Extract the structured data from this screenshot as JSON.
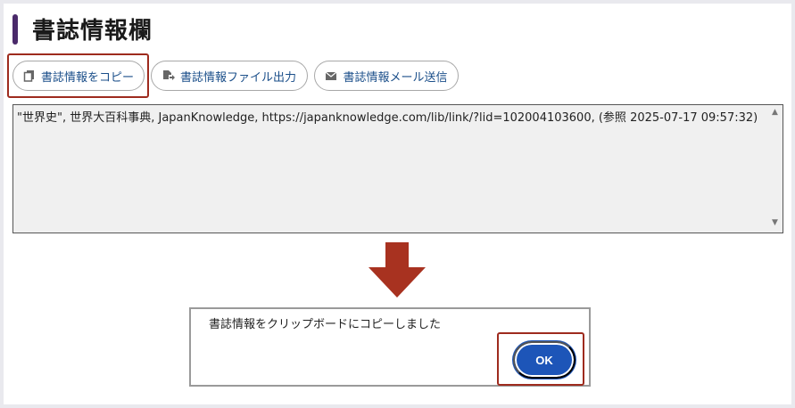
{
  "section": {
    "title": "書誌情報欄"
  },
  "buttons": {
    "copy": {
      "label": "書誌情報をコピー",
      "icon": "copy-icon"
    },
    "file": {
      "label": "書誌情報ファイル出力",
      "icon": "file-export-icon"
    },
    "mail": {
      "label": "書誌情報メール送信",
      "icon": "envelope-icon"
    }
  },
  "citation": {
    "text": "\"世界史\", 世界大百科事典, JapanKnowledge, https://japanknowledge.com/lib/link/?lid=102004103600, (参照 2025-07-17 09:57:32)"
  },
  "dialog": {
    "message": "書誌情報をクリップボードにコピーしました",
    "ok_label": "OK"
  },
  "colors": {
    "accent_bar": "#4a2a6a",
    "highlight": "#9e2b1e",
    "button_text": "#1b4f8a",
    "ok_button": "#1d55b8"
  }
}
